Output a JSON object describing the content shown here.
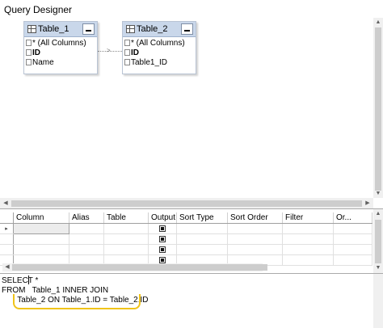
{
  "window": {
    "title": "Query Designer"
  },
  "diagram": {
    "tables": [
      {
        "name": "Table_1",
        "columns": [
          "* (All Columns)",
          "ID",
          "Name"
        ]
      },
      {
        "name": "Table_2",
        "columns": [
          "* (All Columns)",
          "ID",
          "Table1_ID"
        ]
      }
    ]
  },
  "grid": {
    "headers": [
      "Column",
      "Alias",
      "Table",
      "Output",
      "Sort Type",
      "Sort Order",
      "Filter",
      "Or..."
    ],
    "row_marker": "▸"
  },
  "sql": {
    "lines": [
      "SELECT *",
      "FROM   Table_1 INNER JOIN",
      "       Table_2 ON Table_1.ID = Table_2.ID"
    ],
    "highlight_color": "#f0c419"
  },
  "icons": {
    "table": "table-icon",
    "minimize": "minimize-icon",
    "scroll_up": "scroll-up-icon",
    "scroll_down": "scroll-down-icon"
  }
}
